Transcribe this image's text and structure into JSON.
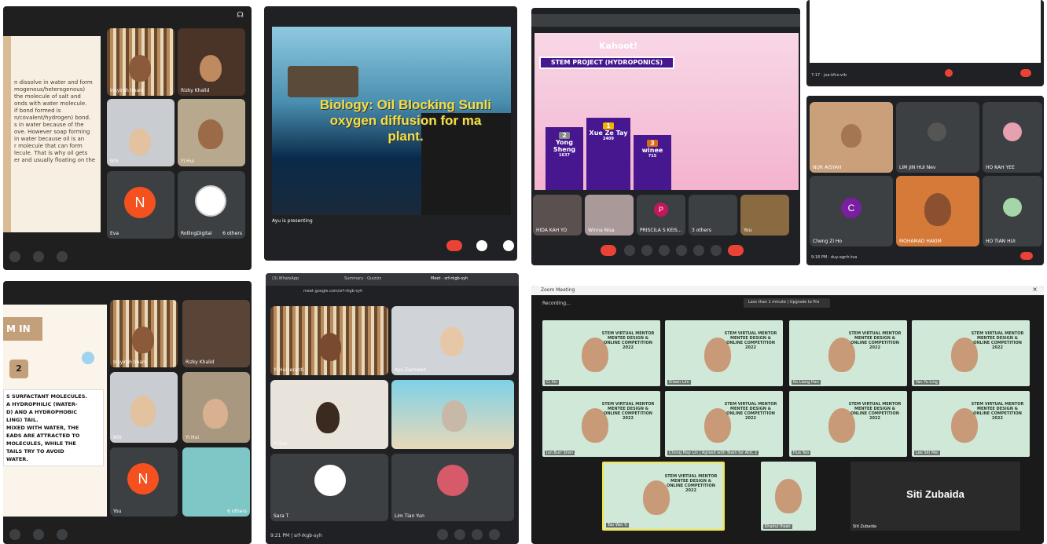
{
  "panel1": {
    "slide_lines": [
      "n dissolve in water and form",
      "mogenous/heterogenous)",
      "the molecule of salt and",
      "onds with water molecule.",
      "if bond formed is",
      "n/covalent/hydrogen) bond.",
      "",
      "s in water because of the",
      "ove. However soap forming",
      "",
      "in water because oil is an",
      "",
      "r molecule that can form",
      "lecule. That is why oil gets",
      "er and usually floating on the"
    ],
    "tiles": [
      {
        "name": "Insyirah Imani"
      },
      {
        "name": "Rizky Khalid"
      },
      {
        "name": "Ikhi"
      },
      {
        "name": "Yi Hui"
      },
      {
        "name": "Eva"
      },
      {
        "name": "RollingDigital"
      }
    ],
    "avatar_letter": "N",
    "others": "6 others"
  },
  "panel2": {
    "title_line1": "Biology: Oil Blocking Sunli",
    "title_line2": "oxygen diffusion for ma",
    "title_line3": "plant.",
    "presenter": "Ayu is presenting"
  },
  "panel3": {
    "brand": "Kahoot!",
    "project": "STEM PROJECT (HYDROPONICS)",
    "podium": [
      {
        "rank": "2",
        "name": "Yong Sheng",
        "score": "1637"
      },
      {
        "rank": "1",
        "name": "Xue Ze Tay",
        "score": "2409"
      },
      {
        "rank": "3",
        "name": "winee",
        "score": "715"
      }
    ],
    "bottom_tiles": [
      {
        "name": "HIDA KAH YO"
      },
      {
        "name": "Winna Nisa"
      },
      {
        "name": "PRISCILA S KEIS..."
      },
      {
        "name": "3 others"
      },
      {
        "name": "You"
      }
    ],
    "p_letter": "P"
  },
  "panel4": {
    "footer": "7:17 · jxa-kfcs-vrb"
  },
  "panel5": {
    "footer": "9:18 PM · duy-agnh-tva",
    "c_letter": "C",
    "names": [
      "NUR AISYAH",
      "LIM JIN HUI Nev",
      "HO KAH YEE",
      "Cheng Zi Ho",
      "MOHAMAD HAKIM",
      "HO TIAN HUI"
    ]
  },
  "panel6": {
    "slide_heading": "M IN",
    "slide_num": "2",
    "slide_lines": [
      "S SURFACTANT MOLECULES.",
      "A HYDROPHILIC (WATER-",
      "D) AND A HYDROPHOBIC",
      "LING) TAIL.",
      "MIXED WITH WATER, THE",
      "EADS ARE ATTRACTED TO",
      "MOLECULES, WHILE THE",
      "TAILS TRY TO AVOID",
      "WATER."
    ],
    "avatar_letter": "N",
    "you": "You",
    "others": "6 others",
    "tiles": [
      {
        "name": "Insyirah Imani"
      },
      {
        "name": "Rizky Khalid"
      },
      {
        "name": "Ikhi"
      },
      {
        "name": "Yi Hui"
      }
    ]
  },
  "panel7": {
    "tabs": [
      "(3) WhatsApp",
      "Summary - Quizizz",
      "Meet - srf-rkgb-syh"
    ],
    "url": "meet.google.com/srf-rkgb-syh",
    "tiles": [
      {
        "name": "Yi Hui Jeranti"
      },
      {
        "name": "Ayu Zarmeeh"
      },
      {
        "name": "Yi Hui"
      },
      {
        "name": "Sara T"
      },
      {
        "name": "Lim Tian Yun"
      }
    ],
    "footer": "9:21 PM | srf-rkgb-syh"
  },
  "panel8": {
    "window_title": "Zoom Meeting",
    "recording": "Recording...",
    "banner": "Less than 1 minute | Upgrade to Pro",
    "poster_text": "STEM VIRTUAL MENTOR MENTEE DESIGN & ONLINE COMPETITION 2022",
    "tiles": [
      {
        "name": "Ci Xin"
      },
      {
        "name": "Eileen Lim"
      },
      {
        "name": "Ko Liang Han"
      },
      {
        "name": "Yan Yu Ling"
      },
      {
        "name": "Jun Burr Shen"
      },
      {
        "name": "Chong May Lin | Agreed with Team for ADC 2"
      },
      {
        "name": "Hua Yeo"
      },
      {
        "name": "Lee Siti Mei"
      },
      {
        "name": "Tan Wei Yi"
      },
      {
        "name": "Khairul Ihsan"
      },
      {
        "name": "Siti Zubaida"
      }
    ],
    "big_name": "Siti Zubaida"
  },
  "colors": {
    "meet_bg": "#202124",
    "tile": "#3c4043",
    "red": "#ea4335",
    "orange": "#f4511e",
    "purple": "#7b1fa2",
    "zoom_bg": "#1a1a1a",
    "kahoot_purple": "#46178f"
  }
}
